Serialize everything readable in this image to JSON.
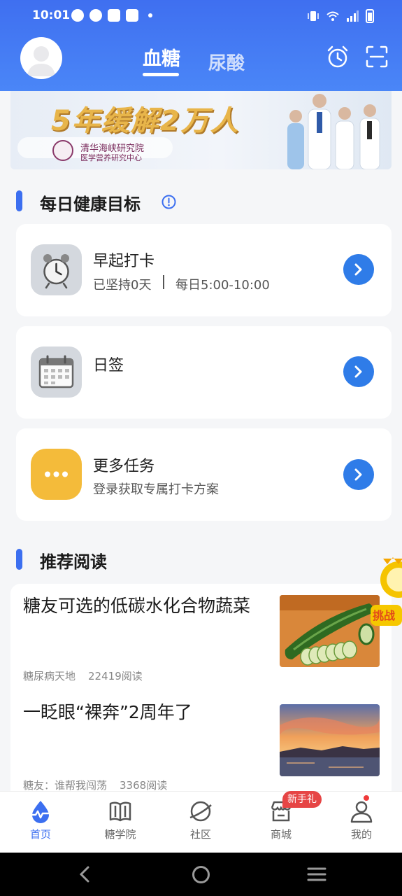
{
  "status_bar": {
    "time": "10:01"
  },
  "header": {
    "tabs": [
      {
        "label": "血糖",
        "active": true
      },
      {
        "label": "尿酸",
        "active": false
      }
    ],
    "accent": "#3f6ff0"
  },
  "banner": {
    "headline": "5年缓解2万人",
    "org_line1": "清华海峡研究院",
    "org_line2": "医学营养研究中心"
  },
  "daily_goals": {
    "title": "每日健康目标",
    "tasks": [
      {
        "title": "早起打卡",
        "subtitle_left": "已坚持0天",
        "subtitle_right": "每日5:00-10:00",
        "icon": "alarm-clock-icon"
      },
      {
        "title": "日签",
        "icon": "calendar-icon"
      },
      {
        "title": "更多任务",
        "subtitle": "登录获取专属打卡方案",
        "icon": "more-dots-icon"
      }
    ]
  },
  "recommended": {
    "title": "推荐阅读",
    "articles": [
      {
        "title": "糖友可选的低碳水化合物蔬菜",
        "source": "糖尿病天地",
        "reads": "22419阅读",
        "image": "cucumber-photo"
      },
      {
        "title": "一眨眼“裸奔”2周年了",
        "source": "糖友：谁帮我闯荡",
        "reads": "3368阅读",
        "image": "sunset-photo"
      }
    ]
  },
  "float_badge": {
    "label": "挑战"
  },
  "bottom_nav": {
    "items": [
      {
        "label": "首页",
        "active": true,
        "icon": "home-drop-icon"
      },
      {
        "label": "糖学院",
        "active": false,
        "icon": "book-icon"
      },
      {
        "label": "社区",
        "active": false,
        "icon": "planet-icon"
      },
      {
        "label": "商城",
        "active": false,
        "icon": "store-icon"
      },
      {
        "label": "我的",
        "active": false,
        "icon": "user-icon"
      }
    ],
    "store_badge": "新手礼"
  }
}
